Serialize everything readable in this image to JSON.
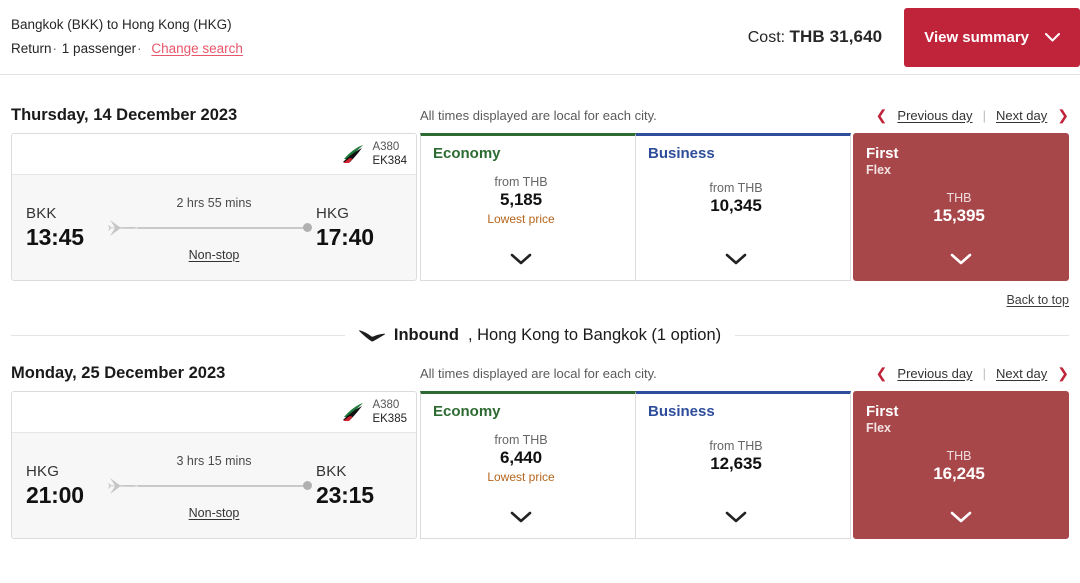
{
  "header": {
    "route": "Bangkok (BKK) to Hong Kong (HKG)",
    "trip_type": "Return",
    "passengers": "1 passenger",
    "change_search_label": "Change search",
    "separator": "·",
    "cost_label": "Cost:",
    "cost_value": "THB 31,640",
    "summary_button_label": "View summary",
    "brand_red": "#c0243a",
    "link_pink": "#e8566b"
  },
  "back_to_top_label": "Back to top",
  "inbound_section": {
    "strong_label": "Inbound",
    "rest_label": ", Hong Kong to Bangkok (1 option)"
  },
  "days": [
    {
      "date_label": "Thursday, 14 December 2023",
      "local_times_note": "All times displayed are local for each city.",
      "previous_day_label": "Previous day",
      "next_day_label": "Next day",
      "flight": {
        "aircraft": "A380",
        "flight_number": "EK384",
        "origin_code": "BKK",
        "origin_time": "13:45",
        "destination_code": "HKG",
        "destination_time": "17:40",
        "duration": "2 hrs 55 mins",
        "stops": "Non-stop"
      },
      "fares": [
        {
          "name": "Economy",
          "sub": "",
          "from_label": "from THB",
          "amount": "5,185",
          "tag": "Lowest price",
          "accent": "#2e6b32",
          "selected": false
        },
        {
          "name": "Business",
          "sub": "",
          "from_label": "from THB",
          "amount": "10,345",
          "tag": "",
          "accent": "#2e4e9b",
          "selected": false
        },
        {
          "name": "First",
          "sub": "Flex",
          "from_label": "THB",
          "amount": "15,395",
          "tag": "",
          "accent": "#a8474a",
          "selected": true
        }
      ]
    },
    {
      "date_label": "Monday, 25 December 2023",
      "local_times_note": "All times displayed are local for each city.",
      "previous_day_label": "Previous day",
      "next_day_label": "Next day",
      "flight": {
        "aircraft": "A380",
        "flight_number": "EK385",
        "origin_code": "HKG",
        "origin_time": "21:00",
        "destination_code": "BKK",
        "destination_time": "23:15",
        "duration": "3 hrs 15 mins",
        "stops": "Non-stop"
      },
      "fares": [
        {
          "name": "Economy",
          "sub": "",
          "from_label": "from THB",
          "amount": "6,440",
          "tag": "Lowest price",
          "accent": "#2e6b32",
          "selected": false
        },
        {
          "name": "Business",
          "sub": "",
          "from_label": "from THB",
          "amount": "12,635",
          "tag": "",
          "accent": "#2e4e9b",
          "selected": false
        },
        {
          "name": "First",
          "sub": "Flex",
          "from_label": "THB",
          "amount": "16,245",
          "tag": "",
          "accent": "#a8474a",
          "selected": true
        }
      ]
    }
  ]
}
